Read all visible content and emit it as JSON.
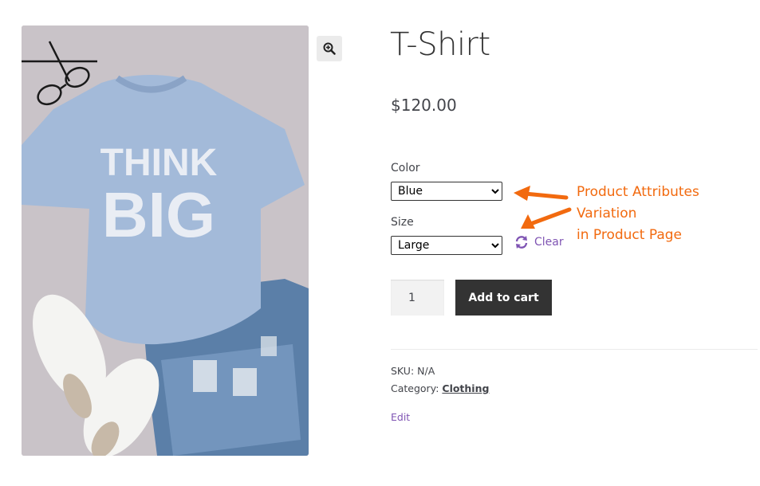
{
  "product": {
    "title": "T-Shirt",
    "price": "$120.00",
    "image_text_line1": "THINK",
    "image_text_line2": "BIG"
  },
  "variations": {
    "color": {
      "label": "Color",
      "selected": "Blue",
      "options": [
        "Blue"
      ]
    },
    "size": {
      "label": "Size",
      "selected": "Large",
      "options": [
        "Large"
      ]
    },
    "clear_label": "Clear"
  },
  "cart": {
    "quantity": "1",
    "add_to_cart_label": "Add to cart"
  },
  "meta": {
    "sku_label": "SKU:",
    "sku_value": "N/A",
    "category_label": "Category:",
    "category_value": "Clothing",
    "edit_label": "Edit"
  },
  "annotation": {
    "line1": "Product Attributes Variation",
    "line2": "in Product Page",
    "color": "#f26a0f"
  },
  "colors": {
    "accent": "#7f54b3",
    "button": "#333333",
    "shirt": "#9fb7d6"
  },
  "icons": {
    "zoom": "zoom-in-icon",
    "clear": "refresh-icon"
  }
}
